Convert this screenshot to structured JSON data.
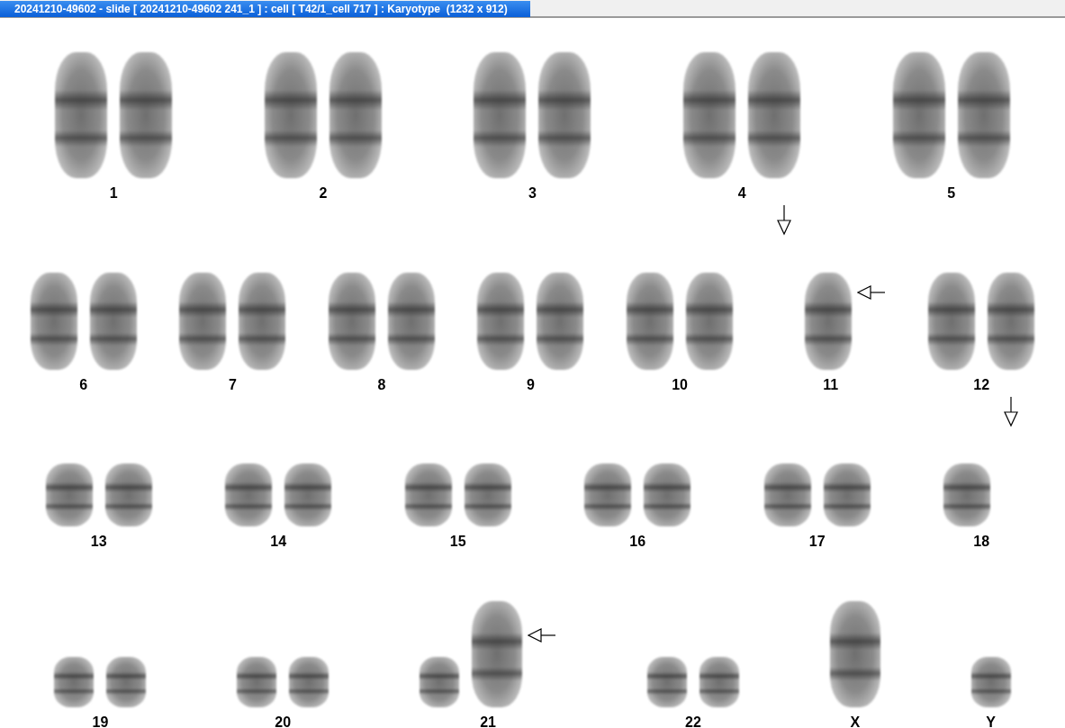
{
  "window": {
    "title": "20241210-49602 - slide [ 20241210-49602 241_1 ] : cell [ T42/1_cell 717 ] : Karyotype  (1232 x 912)"
  },
  "karyotype": {
    "rows": [
      {
        "groups": [
          {
            "label": "1",
            "items": [
              {
                "kind": "chromosome"
              },
              {
                "kind": "chromosome"
              }
            ]
          },
          {
            "label": "2",
            "items": [
              {
                "kind": "chromosome"
              },
              {
                "kind": "chromosome"
              }
            ]
          },
          {
            "label": "3",
            "items": [
              {
                "kind": "chromosome"
              },
              {
                "kind": "chromosome"
              }
            ]
          },
          {
            "label": "4",
            "items": [
              {
                "kind": "chromosome"
              },
              {
                "kind": "chromosome"
              }
            ]
          },
          {
            "label": "5",
            "items": [
              {
                "kind": "chromosome"
              },
              {
                "kind": "chromosome"
              }
            ]
          }
        ]
      },
      {
        "groups": [
          {
            "label": "6",
            "items": [
              {
                "kind": "chromosome"
              },
              {
                "kind": "chromosome"
              }
            ]
          },
          {
            "label": "7",
            "items": [
              {
                "kind": "chromosome"
              },
              {
                "kind": "chromosome"
              }
            ]
          },
          {
            "label": "8",
            "items": [
              {
                "kind": "chromosome"
              },
              {
                "kind": "chromosome"
              }
            ]
          },
          {
            "label": "9",
            "items": [
              {
                "kind": "chromosome"
              },
              {
                "kind": "chromosome"
              }
            ]
          },
          {
            "label": "10",
            "items": [
              {
                "kind": "chromosome"
              },
              {
                "kind": "chromosome"
              }
            ]
          },
          {
            "label": "11",
            "items": [
              {
                "kind": "down-arrow"
              },
              {
                "kind": "chromosome"
              },
              {
                "kind": "left-arrow"
              }
            ]
          },
          {
            "label": "12",
            "items": [
              {
                "kind": "chromosome"
              },
              {
                "kind": "chromosome"
              }
            ]
          }
        ]
      },
      {
        "groups": [
          {
            "label": "13",
            "items": [
              {
                "kind": "chromosome"
              },
              {
                "kind": "chromosome"
              }
            ]
          },
          {
            "label": "14",
            "items": [
              {
                "kind": "chromosome"
              },
              {
                "kind": "chromosome"
              }
            ]
          },
          {
            "label": "15",
            "items": [
              {
                "kind": "chromosome"
              },
              {
                "kind": "chromosome"
              }
            ]
          },
          {
            "label": "16",
            "items": [
              {
                "kind": "chromosome"
              },
              {
                "kind": "chromosome"
              }
            ]
          },
          {
            "label": "17",
            "items": [
              {
                "kind": "chromosome"
              },
              {
                "kind": "chromosome"
              }
            ]
          },
          {
            "label": "18",
            "items": [
              {
                "kind": "chromosome"
              },
              {
                "kind": "down-arrow"
              }
            ]
          }
        ]
      },
      {
        "groups": [
          {
            "label": "19",
            "items": [
              {
                "kind": "chromosome"
              },
              {
                "kind": "chromosome"
              }
            ]
          },
          {
            "label": "20",
            "items": [
              {
                "kind": "chromosome"
              },
              {
                "kind": "chromosome"
              }
            ]
          },
          {
            "label": "21",
            "items": [
              {
                "kind": "chromosome"
              },
              {
                "kind": "tall-chromosome"
              },
              {
                "kind": "left-arrow"
              }
            ]
          },
          {
            "label": "22",
            "items": [
              {
                "kind": "chromosome"
              },
              {
                "kind": "chromosome"
              }
            ]
          },
          {
            "label": "X",
            "items": [
              {
                "kind": "tall-chromosome"
              }
            ]
          },
          {
            "label": "Y",
            "items": [
              {
                "kind": "chromosome"
              }
            ]
          }
        ]
      }
    ]
  }
}
